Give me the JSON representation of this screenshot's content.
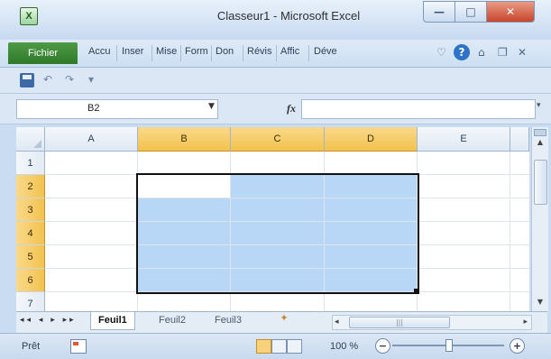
{
  "window": {
    "title": "Classeur1 - Microsoft Excel",
    "app_icon": "excel-icon",
    "controls": {
      "minimize": "—",
      "maximize": "□",
      "close": "✕"
    }
  },
  "ribbon": {
    "file_tab": "Fichier",
    "tabs": [
      "Accu",
      "Inser",
      "Mise",
      "Form",
      "Don",
      "Révis",
      "Affic",
      "Déve"
    ],
    "icons": [
      "heart-icon",
      "help-icon",
      "minimize-ribbon-icon",
      "restore-window-icon",
      "close-window-icon"
    ],
    "help_glyph": "?"
  },
  "quick_access": {
    "undo": "↶",
    "redo": "↷",
    "customize": "▾"
  },
  "formula_bar": {
    "name_box": "B2",
    "fx_label": "fx",
    "formula": ""
  },
  "grid": {
    "columns": [
      "A",
      "B",
      "C",
      "D",
      "E"
    ],
    "selected_columns": [
      "B",
      "C",
      "D"
    ],
    "rows": [
      "1",
      "2",
      "3",
      "4",
      "5",
      "6",
      "7"
    ],
    "selected_rows": [
      "2",
      "3",
      "4",
      "5",
      "6"
    ],
    "selection_range": "B2:D6",
    "active_cell": "B2",
    "selection_color": "#b8d6f5",
    "header_highlight_color": "#f3c24e"
  },
  "sheet_tabs": {
    "nav": "◂◂ ◂ ▸ ▸▸",
    "tabs": [
      "Feuil1",
      "Feuil2",
      "Feuil3"
    ],
    "active": "Feuil1",
    "new_sheet_icon": "new-sheet-icon",
    "hscroll_thumb_glyph": "|||"
  },
  "status_bar": {
    "status": "Prêt",
    "zoom_label": "100 %",
    "zoom_level_percent": 100,
    "zoom_out": "−",
    "zoom_in": "+"
  }
}
